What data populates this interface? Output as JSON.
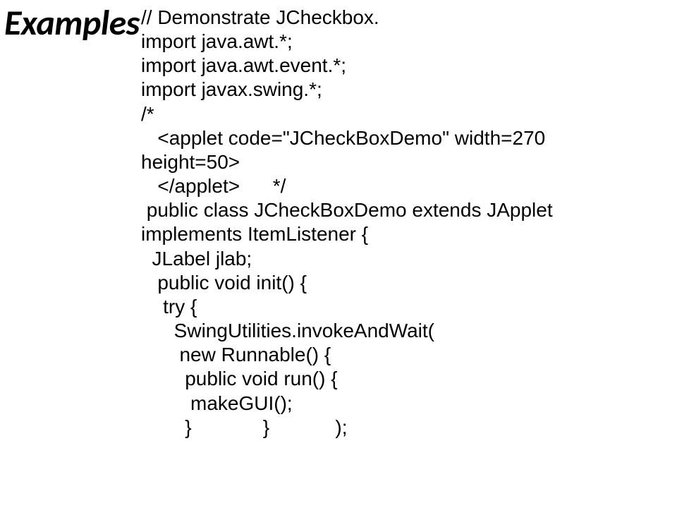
{
  "title": "Examples",
  "code": "// Demonstrate JCheckbox.\nimport java.awt.*;\nimport java.awt.event.*;\nimport javax.swing.*;\n/*\n   <applet code=\"JCheckBoxDemo\" width=270\nheight=50>\n   </applet>      */\n public class JCheckBoxDemo extends JApplet\nimplements ItemListener {\n  JLabel jlab;\n   public void init() {\n    try {\n      SwingUtilities.invokeAndWait(\n       new Runnable() {\n        public void run() {\n         makeGUI();\n        }             }            );"
}
